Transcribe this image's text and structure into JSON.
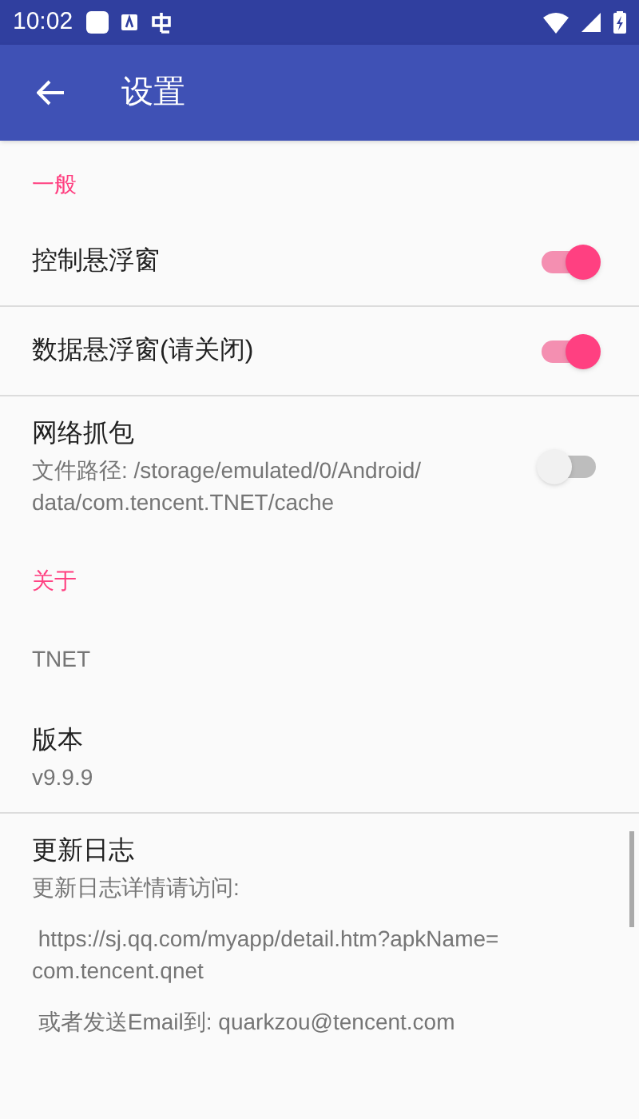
{
  "status_bar": {
    "time": "10:02"
  },
  "app_bar": {
    "title": "设置"
  },
  "items": [
    {
      "kind": "header",
      "title": "一般"
    },
    {
      "kind": "switch",
      "title": "控制悬浮窗",
      "on": true,
      "divider": true
    },
    {
      "kind": "switch",
      "title": "数据悬浮窗(请关闭)",
      "on": true,
      "divider": true
    },
    {
      "kind": "switch",
      "title": "网络抓包",
      "summary": [
        "文件路径: /storage/emulated/0/Android/ data/com.tencent.TNET/cache"
      ],
      "on": false,
      "divider": false
    },
    {
      "kind": "header",
      "title": "关于"
    },
    {
      "kind": "info",
      "summary": [
        "TNET"
      ],
      "divider": false
    },
    {
      "kind": "info",
      "title": "版本",
      "summary": [
        "v9.9.9"
      ],
      "divider": true
    },
    {
      "kind": "info",
      "title": "更新日志",
      "summary": [
        "更新日志详情请访问:",
        " https://sj.qq.com/myapp/detail.htm?apkName= com.tencent.qnet",
        " 或者发送Email到: quarkzou@tencent.com"
      ],
      "divider": false
    }
  ]
}
